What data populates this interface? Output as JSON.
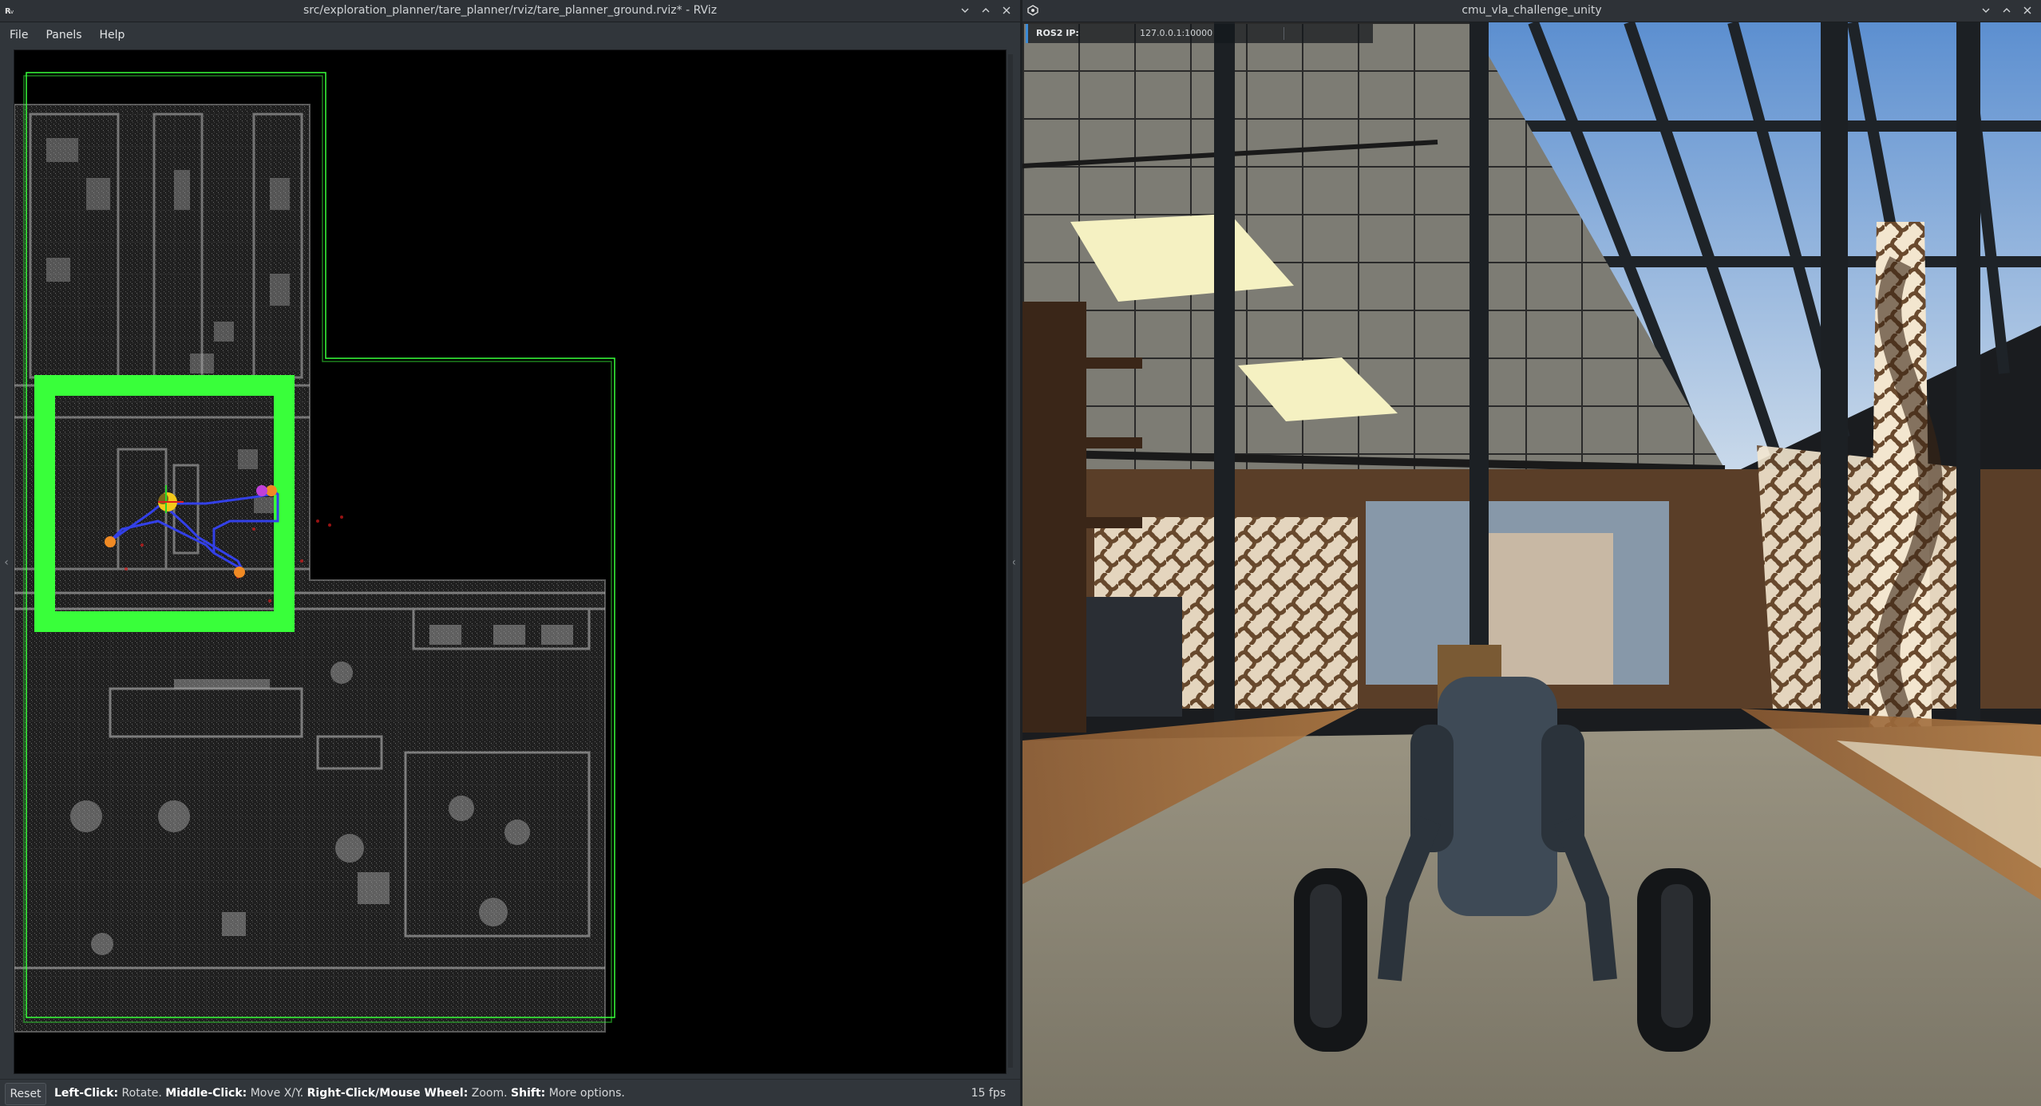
{
  "rviz": {
    "window_title": "src/exploration_planner/tare_planner/rviz/tare_planner_ground.rviz* - RViz",
    "app_icon": "rviz-icon",
    "menu": [
      "File",
      "Panels",
      "Help"
    ],
    "status": {
      "reset_label": "Reset",
      "hint": {
        "a_key": "Left-Click:",
        "a_text": " Rotate. ",
        "b_key": "Middle-Click:",
        "b_text": " Move X/Y. ",
        "c_key": "Right-Click/Mouse Wheel:",
        "c_text": " Zoom. ",
        "d_key": "Shift:",
        "d_text": " More options."
      },
      "fps": "15 fps"
    }
  },
  "unity": {
    "window_title": "cmu_vla_challenge_unity",
    "app_icon": "unity-icon",
    "ros_label": "ROS2 IP:",
    "ros_ip": "127.0.0.1:10000"
  },
  "colors": {
    "exploration_boundary": "#39ff3a",
    "path": "#3340e8",
    "waypoint": "#f08a24",
    "goal": "#c040d8",
    "robot": "#f2c81a"
  }
}
